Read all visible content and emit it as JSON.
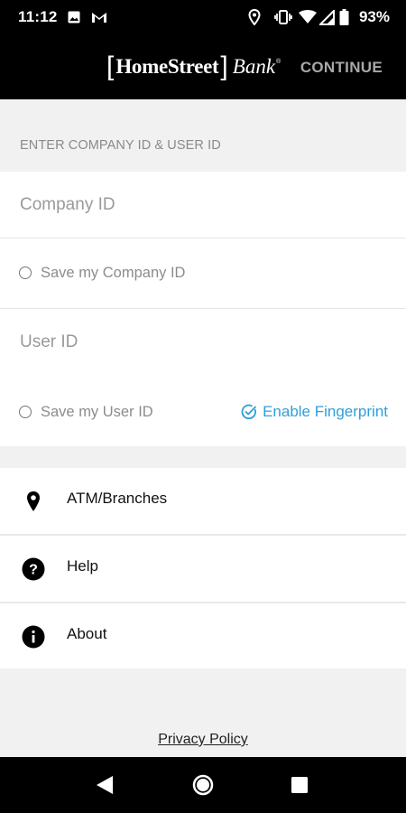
{
  "status_bar": {
    "time": "11:12",
    "battery": "93%",
    "icons": [
      "image-icon",
      "gmail-icon",
      "location-icon",
      "vibrate-icon",
      "wifi-icon",
      "signal-icon",
      "battery-icon"
    ]
  },
  "header": {
    "logo_home": "HomeStreet",
    "logo_bank": "Bank",
    "continue_label": "CONTINUE"
  },
  "form": {
    "section_label": "ENTER COMPANY ID & USER ID",
    "company_id_placeholder": "Company ID",
    "save_company_label": "Save my Company ID",
    "user_id_placeholder": "User ID",
    "save_user_label": "Save my User ID",
    "fingerprint_label": "Enable Fingerprint"
  },
  "menu": {
    "items": [
      {
        "label": "ATM/Branches",
        "icon": "location-pin-icon"
      },
      {
        "label": "Help",
        "icon": "help-icon"
      },
      {
        "label": "About",
        "icon": "info-icon"
      }
    ]
  },
  "footer": {
    "privacy_label": "Privacy Policy"
  },
  "colors": {
    "accent": "#2f9fd9",
    "header_bg": "#000000",
    "page_bg": "#f1f1f1"
  }
}
